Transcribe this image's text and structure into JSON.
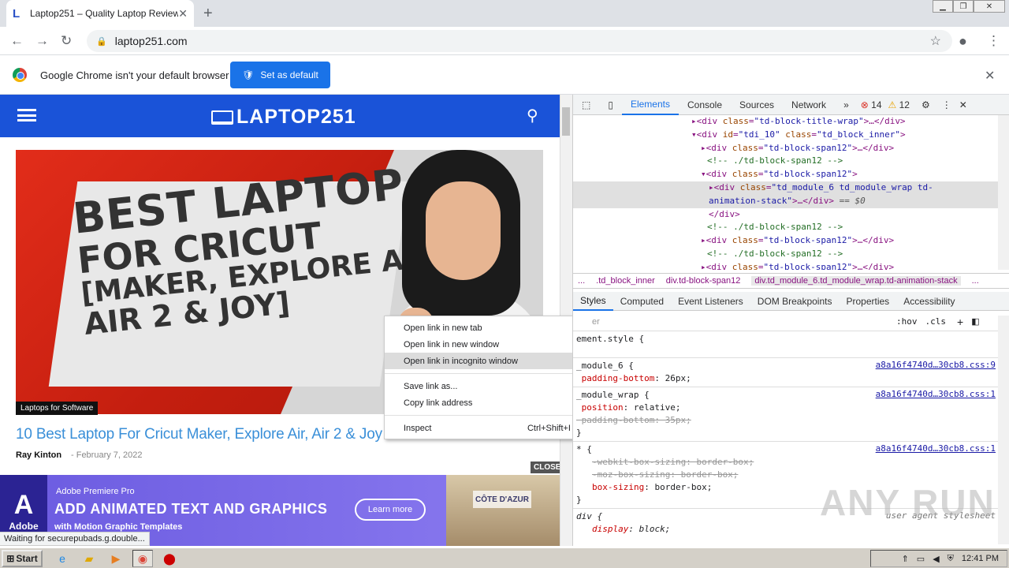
{
  "browser": {
    "tab_title": "Laptop251 – Quality Laptop Reviews",
    "tab_favicon": "L",
    "url": "laptop251.com"
  },
  "infobar": {
    "message": "Google Chrome isn't your default browser",
    "button": "Set as default"
  },
  "site": {
    "logo": "LAPTOP251",
    "hero_lines": [
      "BEST LAPTOP",
      "FOR CRICUT",
      "[MAKER, EXPLORE AIR,",
      "AIR 2 & JOY]"
    ],
    "badge": "Laptops for Software",
    "article_title": "10 Best Laptop For Cricut Maker, Explore Air, Air 2 & Joy in 2022",
    "author": "Ray Kinton",
    "date": "- February 7, 2022",
    "close": "CLOSE"
  },
  "ad": {
    "brand": "Adobe",
    "product": "Adobe Premiere Pro",
    "headline": "ADD ANIMATED TEXT AND GRAPHICS",
    "sub": "with Motion Graphic Templates",
    "cta": "Learn more",
    "image_text": "CÔTE D'AZUR"
  },
  "status_text": "Waiting for securepubads.g.double...",
  "context_menu": {
    "items": [
      "Open link in new tab",
      "Open link in new window",
      "Open link in incognito window",
      "Save link as...",
      "Copy link address",
      "Inspect"
    ],
    "inspect_shortcut": "Ctrl+Shift+I"
  },
  "devtools": {
    "tabs": [
      "Elements",
      "Console",
      "Sources",
      "Network"
    ],
    "errors": "14",
    "warnings": "12",
    "breadcrumbs": [
      "...",
      ".td_block_inner",
      "div.td-block-span12",
      "div.td_module_6.td_module_wrap.td-animation-stack",
      "..."
    ],
    "subtabs": [
      "Styles",
      "Computed",
      "Event Listeners",
      "DOM Breakpoints",
      "Properties",
      "Accessibility"
    ],
    "filter_placeholder": "er",
    "hov": ":hov",
    "cls": ".cls",
    "src1": "a8a16f4740d…30cb8.css:9",
    "src2": "a8a16f4740d…30cb8.css:1",
    "src3": "a8a16f4740d…30cb8.css:1",
    "user_agent": "user agent stylesheet"
  },
  "watermark": "ANY RUN",
  "taskbar": {
    "start": "Start",
    "time": "12:41 PM"
  }
}
